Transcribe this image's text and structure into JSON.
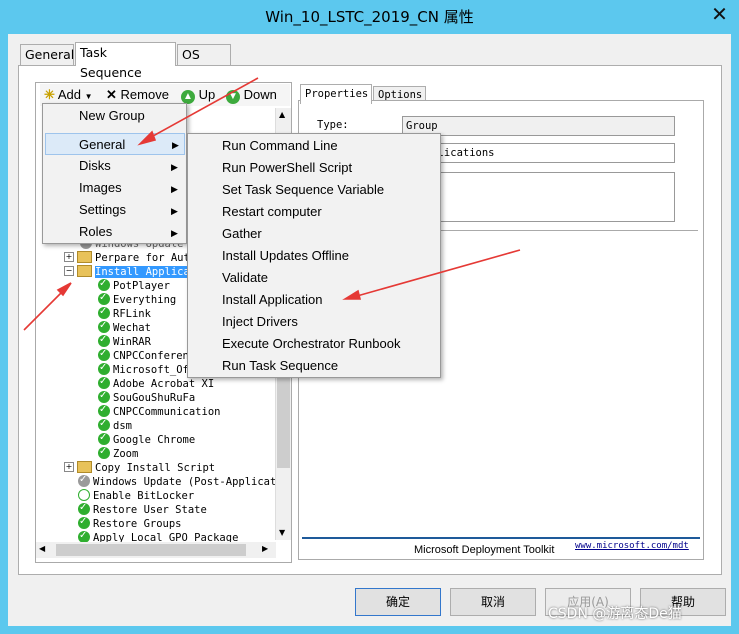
{
  "window": {
    "title": "Win_10_LSTC_2019_CN 属性",
    "close_glyph": "✕"
  },
  "tabs": [
    "General",
    "Task Sequence",
    "OS Info"
  ],
  "toolbar": {
    "add": "Add",
    "remove": "Remove",
    "up": "Up",
    "down": "Down"
  },
  "add_menu": [
    "New Group",
    "General",
    "Disks",
    "Images",
    "Settings",
    "Roles"
  ],
  "general_submenu": [
    "Run Command Line",
    "Run PowerShell Script",
    "Set Task Sequence Variable",
    "Restart computer",
    "Gather",
    "Install Updates Offline",
    "Validate",
    "Install Application",
    "Inject Drivers",
    "Execute Orchestrator Runbook",
    "Run Task Sequence"
  ],
  "tree": {
    "partial_top": "Windows Update",
    "rows": [
      {
        "label": "Perpare for Aut",
        "type": "folder",
        "expand": "+"
      },
      {
        "label": "Install Applica",
        "type": "folder",
        "expand": "-",
        "selected": true
      },
      {
        "label": "PotPlayer",
        "type": "check"
      },
      {
        "label": "Everything",
        "type": "check"
      },
      {
        "label": "RFLink",
        "type": "check"
      },
      {
        "label": "Wechat",
        "type": "check"
      },
      {
        "label": "WinRAR",
        "type": "check"
      },
      {
        "label": "CNPCConferen",
        "type": "check"
      },
      {
        "label": "Microsoft_Of",
        "type": "check"
      },
      {
        "label": "Adobe Acrobat XI",
        "type": "check"
      },
      {
        "label": "SouGouShuRuFa",
        "type": "check"
      },
      {
        "label": "CNPCCommunication",
        "type": "check"
      },
      {
        "label": "dsm",
        "type": "check"
      },
      {
        "label": "Google Chrome",
        "type": "check"
      },
      {
        "label": "Zoom",
        "type": "check"
      },
      {
        "label": "Copy Install Script",
        "type": "folder",
        "expand": "+"
      },
      {
        "label": "Windows Update (Post-Applicati",
        "type": "grey"
      },
      {
        "label": "Enable BitLocker",
        "type": "check-outline"
      },
      {
        "label": "Restore User State",
        "type": "check"
      },
      {
        "label": "Restore Groups",
        "type": "check"
      },
      {
        "label": "Apply Local GPO Package",
        "type": "check"
      }
    ]
  },
  "right_tabs": [
    "Properties",
    "Options"
  ],
  "properties": {
    "type_label": "Type:",
    "type_value": "Group",
    "name_value_partial": "l Applications"
  },
  "footer": {
    "mdt_text": "Microsoft Deployment Toolkit",
    "mdt_link": "www.microsoft.com/mdt"
  },
  "buttons": {
    "ok": "确定",
    "cancel": "取消",
    "apply": "应用(A)",
    "help": "帮助"
  },
  "watermark": "CSDN @游离态De猫"
}
